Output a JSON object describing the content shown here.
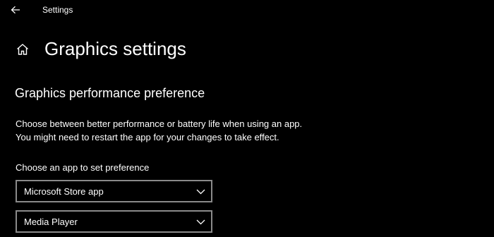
{
  "titlebar": {
    "title": "Settings",
    "back_icon": "back-arrow-icon"
  },
  "header": {
    "home_icon": "home-icon",
    "page_title": "Graphics settings"
  },
  "section": {
    "title": "Graphics performance preference",
    "description_line1": "Choose between better performance or battery life when using an app.",
    "description_line2": "You might need to restart the app for your changes to take effect.",
    "choose_label": "Choose an app to set preference",
    "app_type_dropdown": {
      "value": "Microsoft Store app",
      "icon": "chevron-down-icon"
    },
    "app_dropdown": {
      "value": "Media Player",
      "icon": "chevron-down-icon"
    }
  },
  "colors": {
    "background": "#000000",
    "text": "#ffffff",
    "dropdown_border": "#8a8a8a"
  }
}
